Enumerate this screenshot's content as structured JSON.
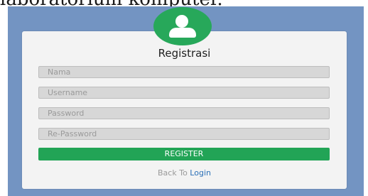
{
  "caption": {
    "text": "laboratorium komputer."
  },
  "form": {
    "title": "Registrasi",
    "avatar_icon": "user-icon",
    "fields": {
      "nama": {
        "placeholder": "Nama",
        "value": ""
      },
      "username": {
        "placeholder": "Username",
        "value": ""
      },
      "password": {
        "placeholder": "Password",
        "value": ""
      },
      "repassword": {
        "placeholder": "Re-Password",
        "value": ""
      }
    },
    "register_label": "REGISTER",
    "back_text": "Back To",
    "login_label": "Login"
  },
  "colors": {
    "background": "#7394c2",
    "card": "#f3f3f3",
    "accent": "#27a85a",
    "button": "#22a456",
    "link": "#2a6fb7",
    "field": "#d7d7d7"
  }
}
